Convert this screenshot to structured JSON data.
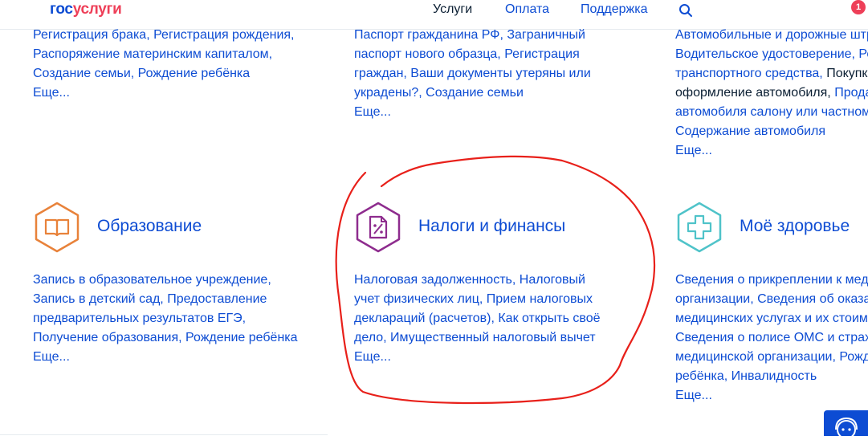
{
  "header": {
    "logo_part1": "гос",
    "logo_part2": "услуги",
    "nav": {
      "services": "Услуги",
      "payment": "Оплата",
      "support": "Поддержка"
    },
    "notification_count": "1"
  },
  "top_row": {
    "family": {
      "links": "Регистрация брака, Регистрация рождения, Распоряжение материнским капиталом, Создание семьи, Рождение ребёнка",
      "more": "Еще..."
    },
    "passport": {
      "links": "Паспорт гражданина РФ, Заграничный паспорт нового образца, Регистрация граждан, Ваши документы утеряны или украдены?, Создание семьи",
      "more": "Еще..."
    },
    "transport": {
      "line1": "Автомобильные и дорожные штр",
      "line2": "Водительское удостоверение, Ре",
      "line3_blue": "транспортного средства, ",
      "line3_dark": "Покупк",
      "line4_dark": "оформление автомобиля, ",
      "line4_blue": "Прода",
      "line5": "автомобиля салону или частном",
      "line6": "Содержание автомобиля",
      "more": "Еще..."
    }
  },
  "categories": {
    "education": {
      "title": "Образование",
      "links": "Запись в образовательное учреждение, Запись в детский сад, Предоставление предварительных результатов ЕГЭ, Получение образования, Рождение ребёнка",
      "more": "Еще..."
    },
    "taxes": {
      "title": "Налоги и финансы",
      "links": "Налоговая задолженность, Налоговый учет физических лиц, Прием налоговых деклараций (расчетов), Как открыть своё дело, Имущественный налоговый вычет",
      "more": "Еще..."
    },
    "health": {
      "title": "Моё здоровье",
      "line1": "Сведения о прикреплении к мед",
      "line2": "организации, Сведения об оказа",
      "line3": "медицинских услугах и их стоим",
      "line4": "Сведения о полисе ОМС и страх",
      "line5": "медицинской организации, Рожд",
      "line6": "ребёнка, Инвалидность",
      "more": "Еще..."
    }
  },
  "colors": {
    "brand_blue": "#0d4cd3",
    "brand_red": "#ee3f58",
    "education_orange": "#e8823a",
    "taxes_purple": "#8e2c8e",
    "health_teal": "#4fc3c9",
    "annotation_red": "#e8201a"
  },
  "icons": [
    "search-icon",
    "book-icon",
    "tax-document-icon",
    "medical-cross-icon",
    "chat-bot-icon"
  ]
}
